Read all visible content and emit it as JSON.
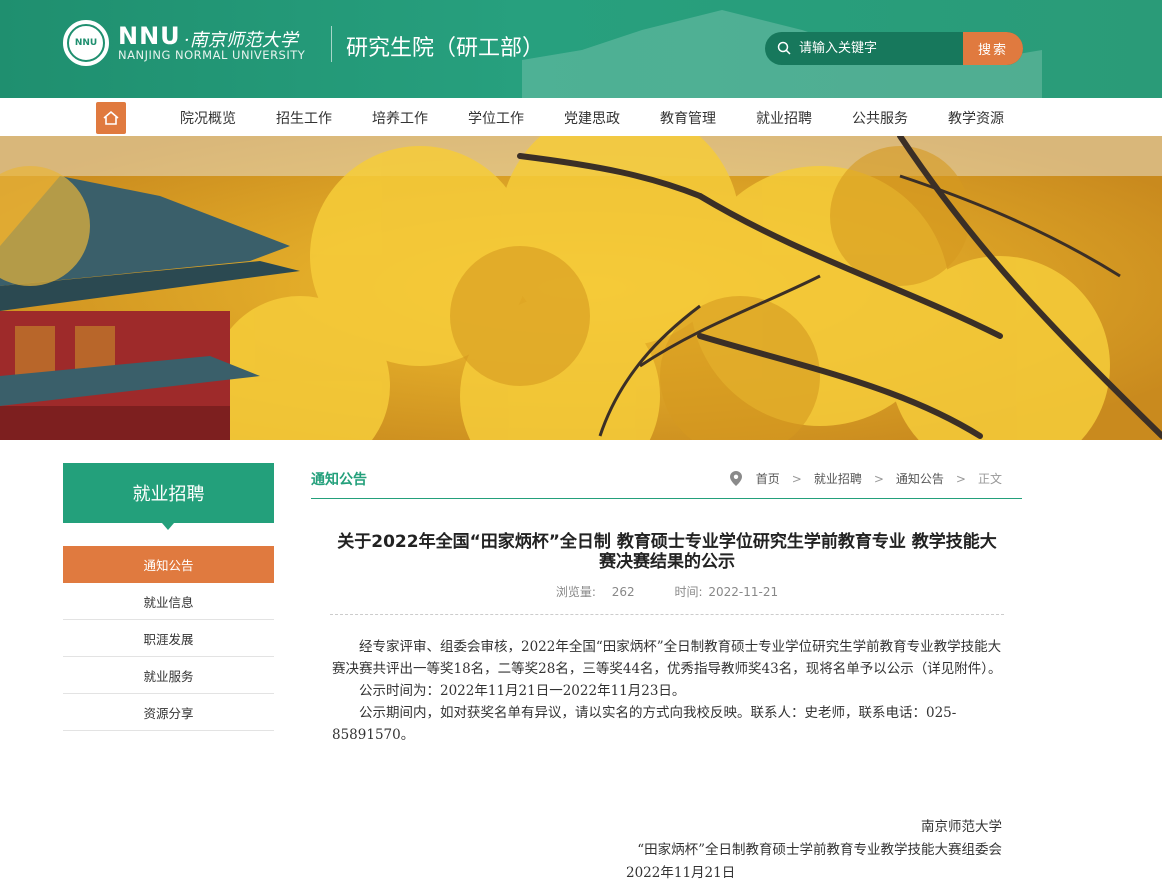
{
  "header": {
    "logo_badge_text": "NNU",
    "logo_nnu": "NNU",
    "logo_cn": "·南京师范大学",
    "logo_en": "NANJING NORMAL UNIVERSITY",
    "site_name": "研究生院（研工部）",
    "search_placeholder": "请输入关键字",
    "search_button": "搜索"
  },
  "nav": {
    "items": [
      "院况概览",
      "招生工作",
      "培养工作",
      "学位工作",
      "党建思政",
      "教育管理",
      "就业招聘",
      "公共服务",
      "教学资源"
    ]
  },
  "sidebar": {
    "title": "就业招聘",
    "items": [
      "通知公告",
      "就业信息",
      "职涯发展",
      "就业服务",
      "资源分享"
    ]
  },
  "breadcrumb": {
    "section": "通知公告",
    "home": "首页",
    "level1": "就业招聘",
    "level2": "通知公告",
    "current": "正文",
    "separator": ">"
  },
  "article": {
    "title": "关于2022年全国“田家炳杯”全日制 教育硕士专业学位研究生学前教育专业 教学技能大赛决赛结果的公示",
    "views_label": "浏览量:",
    "views": "262",
    "time_label": "时间:",
    "time": "2022-11-21",
    "paragraphs": [
      "经专家评审、组委会审核，2022年全国“田家炳杯”全日制教育硕士专业学位研究生学前教育专业教学技能大赛决赛共评出一等奖18名，二等奖28名，三等奖44名，优秀指导教师奖43名，现将名单予以公示（详见附件）。",
      "公示时间为：2022年11月21日一2022年11月23日。",
      "公示期间内，如对获奖名单有异议，请以实名的方式向我校反映。联系人：史老师，联系电话：025-85891570。"
    ],
    "sign_org": "南京师范大学",
    "sign_committee": "“田家炳杯”全日制教育硕士学前教育专业教学技能大赛组委会",
    "sign_date": "2022年11月21日"
  },
  "colors": {
    "brand_green": "#23a07b",
    "accent_orange": "#e07a3f"
  }
}
